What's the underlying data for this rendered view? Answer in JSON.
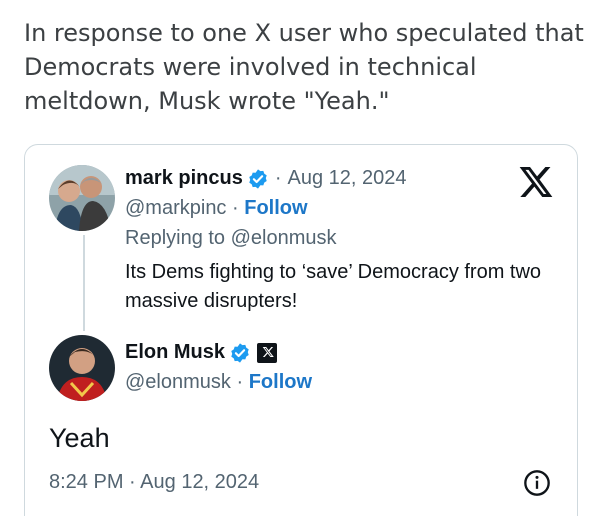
{
  "article": {
    "paragraph": "In response to one X user who speculated that Democrats were involved in technical meltdown, Musk wrote \"Yeah.\""
  },
  "quoted_tweet": {
    "author": {
      "name": "mark pincus",
      "handle": "@markpinc",
      "follow_label": "Follow",
      "verified": true
    },
    "separator": "·",
    "date": "Aug 12, 2024",
    "replying_to": "Replying to @elonmusk",
    "text": "Its Dems fighting to ‘save’ Democracy from two massive disrupters!"
  },
  "main_tweet": {
    "author": {
      "name": "Elon Musk",
      "handle": "@elonmusk",
      "follow_label": "Follow",
      "verified": true,
      "affiliation": "x-logo-badge"
    },
    "separator": "·",
    "text": "Yeah",
    "time": "8:24 PM",
    "date": "Aug 12, 2024"
  },
  "icons": {
    "brand": "x-logo-icon",
    "verified": "verified-badge-icon",
    "info": "info-icon"
  },
  "colors": {
    "verified_blue": "#1d9bf0",
    "follow_blue": "#1d77c8",
    "secondary_text": "#536471",
    "border": "#cfd9de"
  }
}
